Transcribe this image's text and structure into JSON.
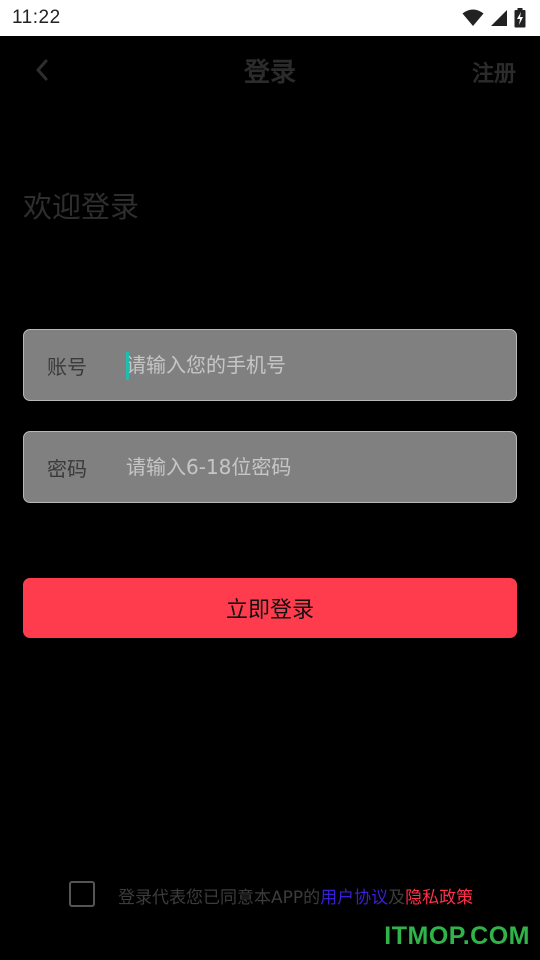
{
  "status_bar": {
    "time": "11:22",
    "icons": [
      "wifi-icon",
      "signal-icon",
      "battery-charging-icon"
    ]
  },
  "nav": {
    "back_icon": "chevron-left-icon",
    "title": "登录",
    "register_label": "注册"
  },
  "welcome": "欢迎登录",
  "account_field": {
    "label": "账号",
    "placeholder": "请输入您的手机号",
    "value": ""
  },
  "password_field": {
    "label": "密码",
    "placeholder": "请输入6-18位密码",
    "value": ""
  },
  "login_button": "立即登录",
  "agreement": {
    "checked": false,
    "prefix": "登录代表您已同意本APP的",
    "user_agreement": "用户协议",
    "conjunction": "及",
    "privacy_policy": "隐私政策"
  },
  "watermark": "ITMOP.COM",
  "colors": {
    "background": "#000000",
    "primary_button": "#ff3b4e",
    "field_background": "#808080",
    "caret": "#21bcb0",
    "user_agreement_link": "#3a1fd8",
    "privacy_link": "#ff3048",
    "watermark": "#2fb44a"
  }
}
